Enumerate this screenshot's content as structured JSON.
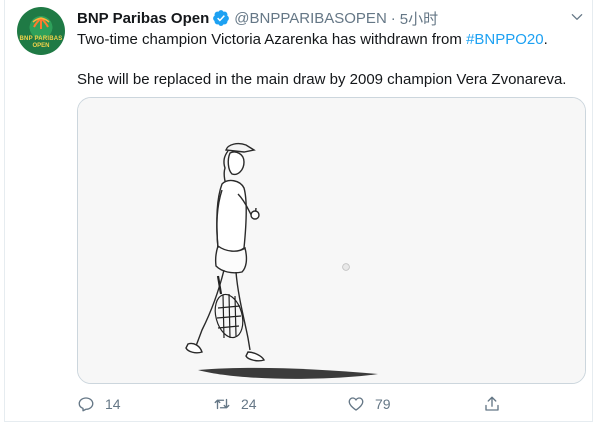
{
  "tweet": {
    "author_name": "BNP Paribas Open",
    "handle": "@BNPPARIBASOPEN",
    "separator": "·",
    "time": "5小时",
    "avatar_text_line1": "BNP PARIBAS",
    "avatar_text_line2": "OPEN",
    "line1_text": "Two-time champion Victoria Azarenka has withdrawn from ",
    "hashtag": "#BNPPO20",
    "line1_end": ".",
    "line2_text": "She will be replaced in the main draw by 2009 champion Vera Zvonareva."
  },
  "actions": {
    "reply_count": "14",
    "retweet_count": "24",
    "like_count": "79"
  },
  "colors": {
    "accent": "#1da1f2",
    "secondary_text": "#657786",
    "avatar_bg": "#1f7a45"
  },
  "icons": [
    "verified-badge-icon",
    "chevron-down-icon",
    "reply-icon",
    "retweet-icon",
    "like-icon",
    "share-icon"
  ]
}
